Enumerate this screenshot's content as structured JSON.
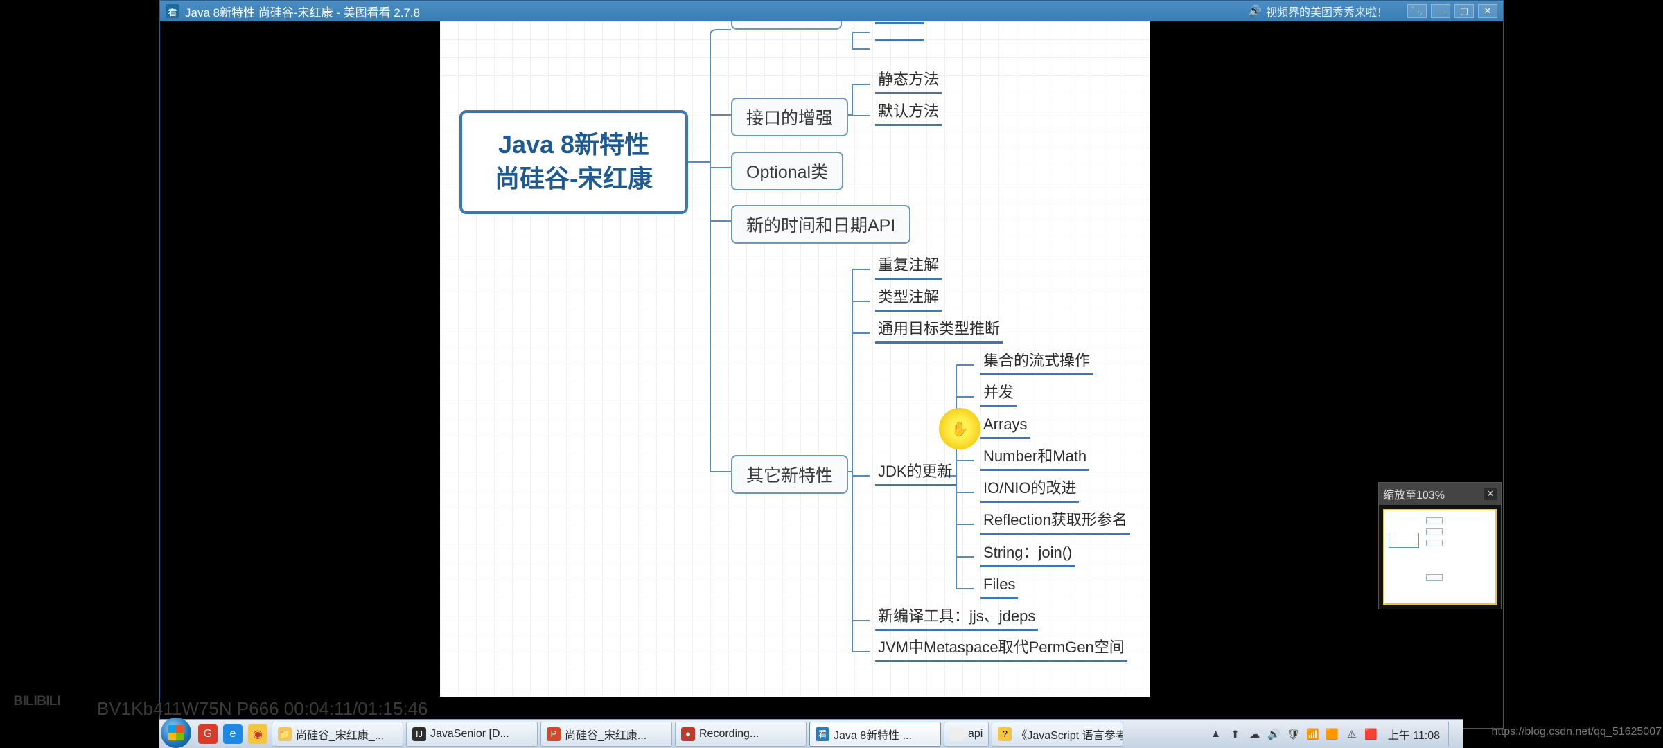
{
  "titlebar": {
    "app_icon_char": "看",
    "title": "Java 8新特性 尚硅谷-宋红康 - 美图看看 2.7.8",
    "banner_text": "视频界的美图秀秀来啦！"
  },
  "mindmap": {
    "root_line1": "Java 8新特性",
    "root_line2": "尚硅谷-宋红康",
    "top_cut1": "",
    "top_cut2": "",
    "interface": {
      "label": "接口的增强",
      "leaves": [
        "静态方法",
        "默认方法"
      ]
    },
    "optional": {
      "label": "Optional类"
    },
    "datetime": {
      "label": "新的时间和日期API"
    },
    "others": {
      "label": "其它新特性",
      "ann1": "重复注解",
      "ann2": "类型注解",
      "ann3": "通用目标类型推断",
      "jdk_update": {
        "label": "JDK的更新",
        "leaves": [
          "集合的流式操作",
          "并发",
          "Arrays",
          "Number和Math",
          "IO/NIO的改进",
          "Reflection获取形参名",
          "String：join()",
          "Files"
        ]
      },
      "tool": "新编译工具：jjs、jdeps",
      "jvm": "JVM中Metaspace取代PermGen空间"
    }
  },
  "zoom_panel": {
    "label": "缩放至103%"
  },
  "taskbar": {
    "quicklaunch": [
      {
        "icon": "G",
        "bg": "#d83b2a",
        "color": "#fff"
      },
      {
        "icon": "e",
        "bg": "#1e88e5",
        "color": "#fff"
      },
      {
        "icon": "◉",
        "bg": "#f5c542",
        "color": "#c0392b"
      }
    ],
    "items": [
      {
        "icon": "📁",
        "icon_bg": "#f4c659",
        "label": "尚硅谷_宋红康_...",
        "active": false,
        "size": "med"
      },
      {
        "icon": "IJ",
        "icon_bg": "#2e2e2e",
        "icon_color": "#fff",
        "label": "JavaSenior [D...",
        "active": false,
        "size": "med"
      },
      {
        "icon": "P",
        "icon_bg": "#d24a2a",
        "icon_color": "#fff",
        "label": "尚硅谷_宋红康...",
        "active": false,
        "size": "med"
      },
      {
        "icon": "●",
        "icon_bg": "#c0392b",
        "icon_color": "#fff",
        "label": "Recording...",
        "active": false,
        "size": "med"
      },
      {
        "icon": "看",
        "icon_bg": "#2a7db5",
        "icon_color": "#fff",
        "label": "Java 8新特性 ...",
        "active": true,
        "size": "med"
      },
      {
        "icon": " ",
        "icon_bg": "#eee",
        "label": "api",
        "active": false,
        "size": "small"
      },
      {
        "icon": "?",
        "icon_bg": "#f5c542",
        "label": "《JavaScript 语言参考...",
        "active": false,
        "size": "med"
      }
    ],
    "tray_icons": [
      "▲",
      "⬆",
      "☁",
      "🔊",
      "🛡",
      "📶",
      "🟧",
      "⚠",
      "🟥"
    ],
    "clock": "上午 11:08"
  },
  "watermarks": {
    "bili_logo": "ᴮᴵᴸᴵᴮᴵᴸᴵ",
    "bili_text": "BV1Kb411W75N P666 00:04:11/01:15:46",
    "csdn": "https://blog.csdn.net/qq_51625007"
  }
}
